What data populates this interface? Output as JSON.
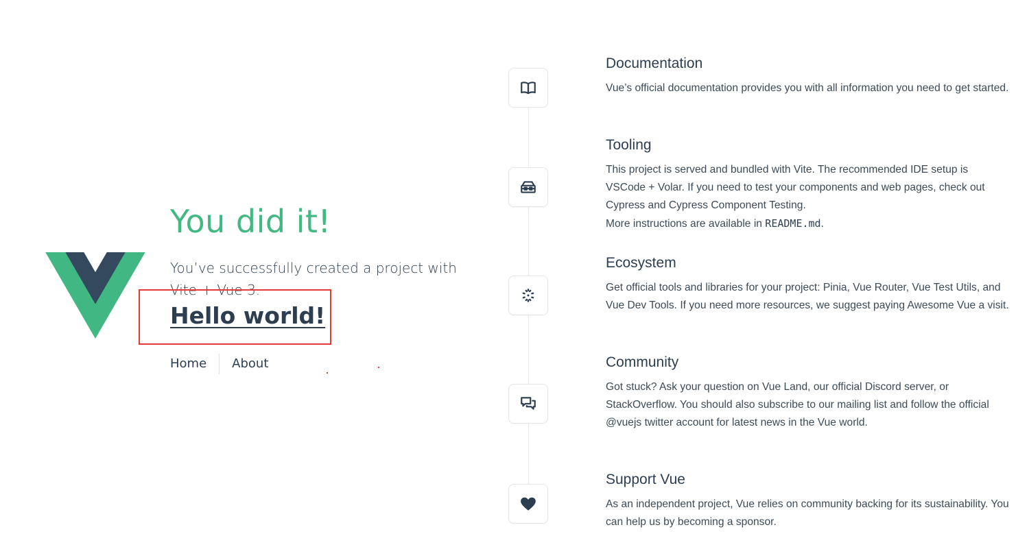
{
  "colors": {
    "accent": "#42b883",
    "text": "#2c3e50",
    "highlight": "#e53935"
  },
  "hero": {
    "title": "You did it!",
    "subtitle": "You’ve successfully created a project with Vite + Vue 3.",
    "link": "Hello world!",
    "logo_icon": "vue-logo-icon"
  },
  "nav": {
    "home": "Home",
    "about": "About"
  },
  "items": [
    {
      "icon": "documentation-book-icon",
      "title": "Documentation",
      "text": "Vue’s official documentation provides you with all information you need to get started."
    },
    {
      "icon": "tooling-toolbox-icon",
      "title": "Tooling",
      "text": "This project is served and bundled with Vite. The recommended IDE setup is VSCode + Volar. If you need to test your components and web pages, check out Cypress and Cypress Component Testing.",
      "text2_prefix": "More instructions are available in ",
      "text2_code": "README.md",
      "text2_suffix": "."
    },
    {
      "icon": "ecosystem-icon",
      "title": "Ecosystem",
      "text": "Get official tools and libraries for your project: Pinia, Vue Router, Vue Test Utils, and Vue Dev Tools. If you need more resources, we suggest paying Awesome Vue a visit."
    },
    {
      "icon": "community-chat-icon",
      "title": "Community",
      "text": "Got stuck? Ask your question on Vue Land, our official Discord server, or StackOverflow. You should also subscribe to our mailing list and follow the official @vuejs twitter account for latest news in the Vue world."
    },
    {
      "icon": "support-heart-icon",
      "title": "Support Vue",
      "text": "As an independent project, Vue relies on community backing for its sustainability. You can help us by becoming a sponsor."
    }
  ]
}
